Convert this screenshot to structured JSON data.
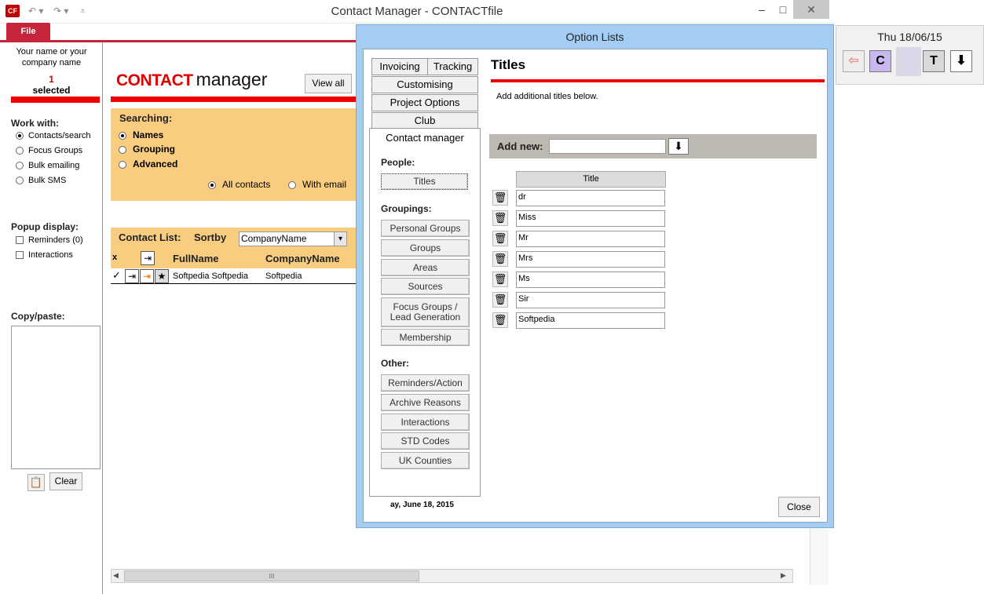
{
  "window": {
    "title": "Contact Manager  -  CONTACTfile",
    "app_icon": "CF",
    "minimize": "–",
    "maximize": "□",
    "close": "✕"
  },
  "ribbon": {
    "file_tab": "File"
  },
  "left_panel": {
    "company_line1": "Your name or your",
    "company_line2": "company name",
    "selected_count": "1",
    "selected_label": "selected",
    "work_with_heading": "Work with:",
    "work_with_options": [
      "Contacts/search",
      "Focus Groups",
      "Bulk emailing",
      "Bulk SMS"
    ],
    "popup_heading": "Popup display:",
    "popup_options": [
      "Reminders (0)",
      "Interactions"
    ],
    "copy_heading": "Copy/paste:",
    "clear_button": "Clear"
  },
  "main": {
    "logo_contact": "CONTACT",
    "logo_manager": "manager",
    "view_all_button": "View all",
    "searching_heading": "Searching:",
    "search_options": [
      "Names",
      "Grouping",
      "Advanced"
    ],
    "scope_all": "All contacts",
    "scope_email": "With email",
    "contact_list_label": "Contact List:",
    "sortby_label": "Sortby",
    "sortby_value": "CompanyName",
    "col_x": "x",
    "col_fullname": "FullName",
    "col_company": "CompanyName",
    "row_check": "✓",
    "row_fullname": "Softpedia Softpedia",
    "row_company": "Softpedia",
    "hscroll_grip": "III"
  },
  "date_panel": {
    "date": "Thu 18/06/15",
    "btn_c": "C",
    "btn_t": "T"
  },
  "dialog": {
    "title": "Option Lists",
    "tabs_row1": [
      "Invoicing",
      "Tracking"
    ],
    "tabs_stack": [
      "Customising",
      "Project Options",
      "Club"
    ],
    "active_tab": "Contact manager",
    "people_heading": "People:",
    "people_items": [
      "Titles"
    ],
    "groupings_heading": "Groupings:",
    "grouping_items": [
      "Personal Groups",
      "Groups",
      "Areas",
      "Sources"
    ],
    "focus_line1": "Focus Groups /",
    "focus_line2": "Lead Generation",
    "membership": "Membership",
    "other_heading": "Other:",
    "other_items": [
      "Reminders/Action",
      "Archive Reasons",
      "Interactions",
      "STD Codes",
      "UK Counties"
    ],
    "footer_date": "ay, June 18, 2015",
    "section_title": "Titles",
    "section_desc": "Add additional titles below.",
    "add_new_label": "Add new:",
    "add_new_value": "",
    "column_header": "Title",
    "titles": [
      "dr",
      "Miss",
      "Mr",
      "Mrs",
      "Ms",
      "Sir",
      "Softpedia"
    ],
    "close_button": "Close"
  }
}
